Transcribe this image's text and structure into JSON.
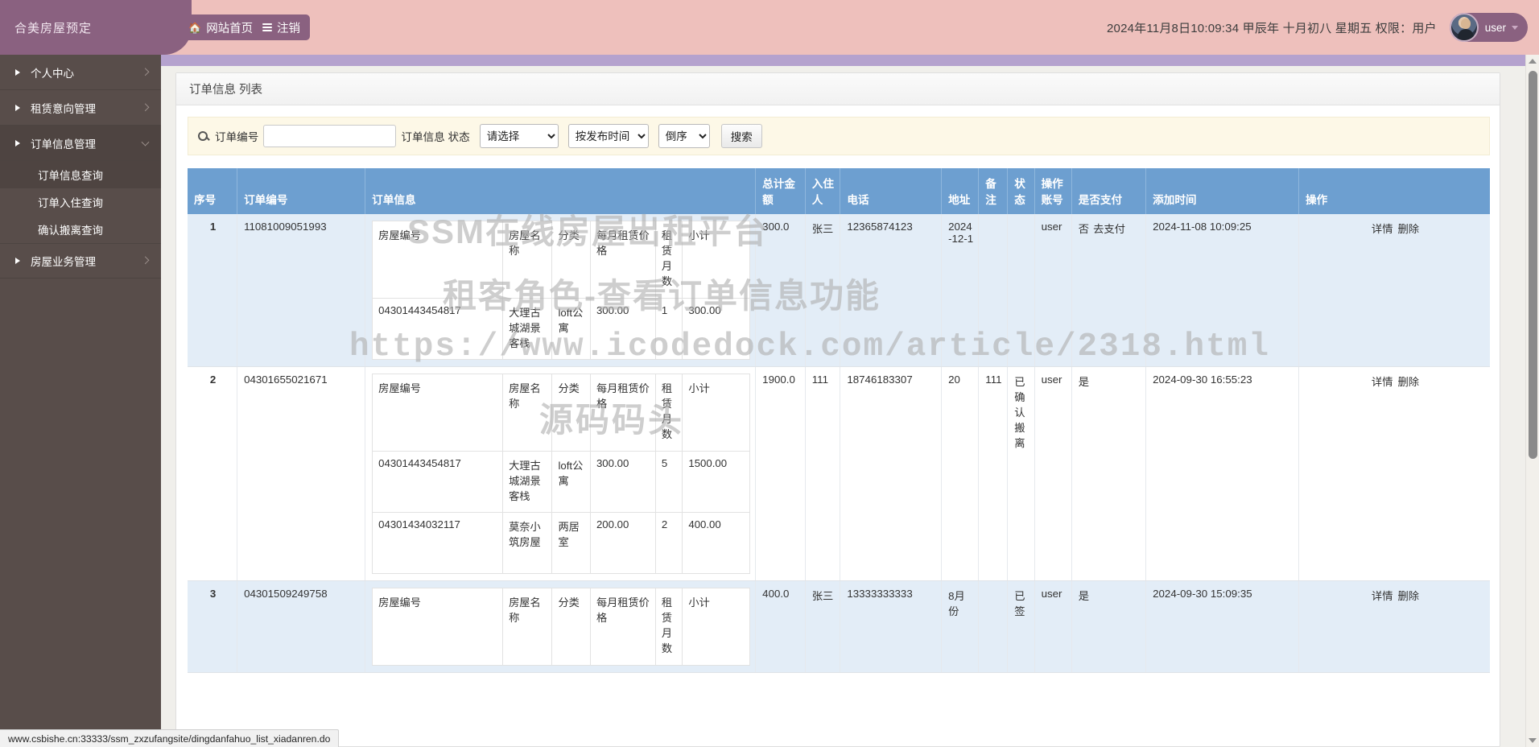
{
  "header": {
    "logo_title": "合美房屋预定",
    "home_button": "网站首页",
    "logout_button": "注销",
    "datetime": "2024年11月8日10:09:34 甲辰年 十月初八 星期五  权限：用户",
    "username": "user"
  },
  "sidebar": {
    "items": [
      {
        "label": "个人中心",
        "type": "parent",
        "expanded": false
      },
      {
        "label": "租赁意向管理",
        "type": "parent",
        "expanded": false
      },
      {
        "label": "订单信息管理",
        "type": "parent",
        "expanded": true
      },
      {
        "label": "订单信息查询",
        "type": "sub",
        "active": true
      },
      {
        "label": "订单入住查询",
        "type": "sub",
        "active": false
      },
      {
        "label": "确认搬离查询",
        "type": "sub",
        "active": false
      },
      {
        "label": "房屋业务管理",
        "type": "parent",
        "expanded": false
      }
    ]
  },
  "panel": {
    "title": "订单信息 列表"
  },
  "search": {
    "order_no_label": "订单编号",
    "order_no_value": "",
    "status_label": "订单信息 状态",
    "status_selected": "请选择",
    "status_options": [
      "请选择"
    ],
    "orderby_selected": "按发布时间",
    "orderby_options": [
      "按发布时间"
    ],
    "direction_selected": "倒序",
    "direction_options": [
      "倒序"
    ],
    "search_button": "搜索"
  },
  "table": {
    "headers": [
      "序号",
      "订单编号",
      "订单信息",
      "总计金额",
      "入住人",
      "电话",
      "地址",
      "备注",
      "状态",
      "操作账号",
      "是否支付",
      "添加时间",
      "操作"
    ],
    "inner_headers": [
      "房屋编号",
      "房屋名称",
      "分类",
      "每月租赁价格",
      "租赁月数",
      "小计"
    ],
    "rows": [
      {
        "idx": "1",
        "order_no": "11081009051993",
        "items": [
          {
            "house_no": "04301443454817",
            "house_name": "大理古城湖景客栈",
            "category": "loft公寓",
            "price": "300.00",
            "months": "1",
            "subtotal": "300.00"
          }
        ],
        "total": "300.0",
        "tenant": "张三",
        "phone": "12365874123",
        "address": "2024-12-1",
        "remark": "",
        "status": "",
        "op_account": "user",
        "paid": "否",
        "pay_link": "去支付",
        "add_time": "2024-11-08 10:09:25",
        "actions": [
          "详情",
          "删除"
        ]
      },
      {
        "idx": "2",
        "order_no": "04301655021671",
        "items": [
          {
            "house_no": "04301443454817",
            "house_name": "大理古城湖景客栈",
            "category": "loft公寓",
            "price": "300.00",
            "months": "5",
            "subtotal": "1500.00"
          },
          {
            "house_no": "04301434032117",
            "house_name": "莫奈小筑房屋",
            "category": "两居室",
            "price": "200.00",
            "months": "2",
            "subtotal": "400.00"
          }
        ],
        "total": "1900.0",
        "tenant": "111",
        "phone": "18746183307",
        "address": "20",
        "remark": "111",
        "status": "已确认搬离",
        "op_account": "user",
        "paid": "是",
        "pay_link": "",
        "add_time": "2024-09-30 16:55:23",
        "actions": [
          "详情",
          "删除"
        ]
      },
      {
        "idx": "3",
        "order_no": "04301509249758",
        "items": [],
        "total": "400.0",
        "tenant": "张三",
        "phone": "13333333333",
        "address": "8月份",
        "remark": "",
        "status": "已签",
        "op_account": "user",
        "paid": "是",
        "pay_link": "",
        "add_time": "2024-09-30 15:09:35",
        "actions": [
          "详情",
          "删除"
        ]
      }
    ]
  },
  "watermark": {
    "line1": "SSM在线房屋出租平台",
    "line2": "租客角色-查看订单信息功能",
    "line3": "https://www.icodedock.com/article/2318.html",
    "line4": "源码码头"
  },
  "statusbar": {
    "url": "www.csbishe.cn:33333/ssm_zxzufangsite/dingdanfahuo_list_xiadanren.do"
  }
}
